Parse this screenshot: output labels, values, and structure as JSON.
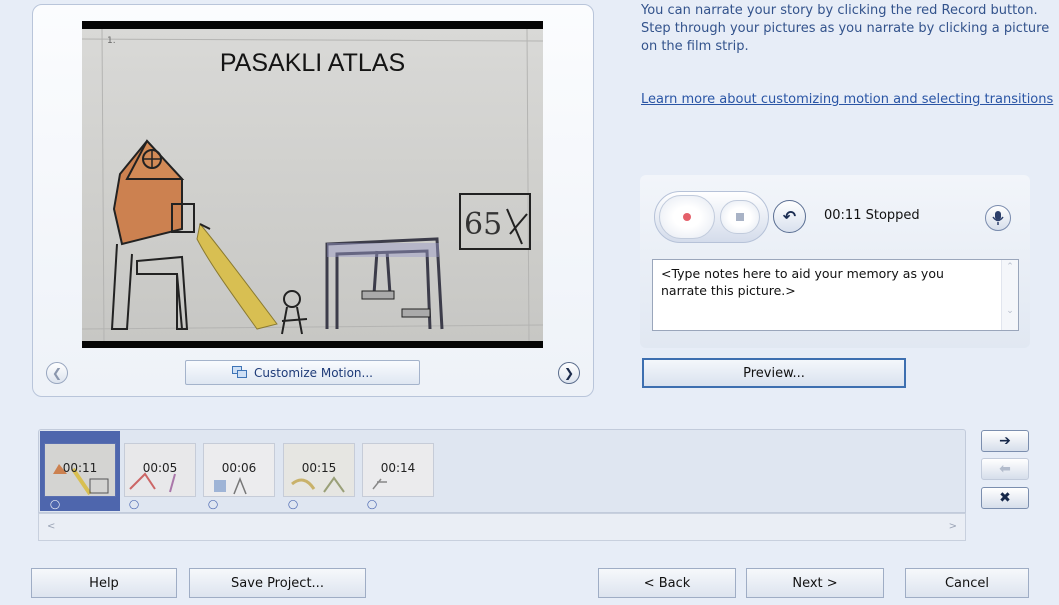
{
  "preview": {
    "slide_title": "PASAKLI ATLAS",
    "customize_motion_label": "Customize Motion...",
    "prev_icon": "chevron-left-icon",
    "next_icon": "chevron-right-icon"
  },
  "instructions": {
    "text": "You can narrate your story by clicking the red Record button. Step through your pictures as you narrate by clicking a picture on the film strip.",
    "link_text": "Learn more about customizing motion and selecting transitions"
  },
  "narration": {
    "time": "00:11",
    "status": "Stopped",
    "notes_text": "<Type notes here to aid your memory as you narrate this picture.>",
    "record_icon": "record-icon",
    "stop_icon": "stop-icon",
    "undo_icon": "undo-icon",
    "mic_icon": "microphone-icon",
    "record_color": "#e4606a"
  },
  "preview_button_label": "Preview...",
  "filmstrip": {
    "thumbnails": [
      {
        "duration": "00:11",
        "selected": true
      },
      {
        "duration": "00:05",
        "selected": false
      },
      {
        "duration": "00:06",
        "selected": false
      },
      {
        "duration": "00:15",
        "selected": false
      },
      {
        "duration": "00:14",
        "selected": false
      }
    ],
    "move_right_icon": "arrow-right-icon",
    "move_left_icon": "arrow-left-icon",
    "remove_icon": "close-icon"
  },
  "buttons": {
    "help": "Help",
    "save_project": "Save Project...",
    "back": "< Back",
    "next": "Next >",
    "cancel": "Cancel"
  },
  "colors": {
    "accent": "#3d6fb0",
    "selection": "#4e66ad",
    "link": "#2a55a5"
  }
}
